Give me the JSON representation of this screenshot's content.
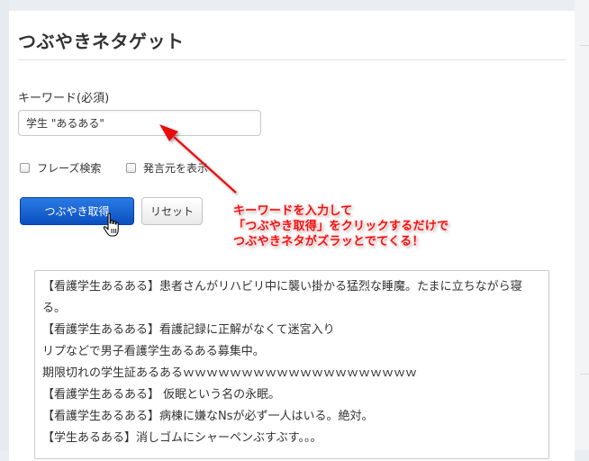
{
  "page": {
    "title": "つぶやきネタゲット"
  },
  "form": {
    "keyword_label": "キーワード(必須)",
    "keyword_value": "学生 \"あるある\"",
    "phrase_search_label": "フレーズ検索",
    "show_speaker_label": "発言元を表示",
    "submit_label": "つぶやき取得",
    "reset_label": "リセット"
  },
  "annotation": {
    "lines": [
      "キーワードを入力して",
      "「つぶやき取得」をクリックするだけで",
      "つぶやきネタがズラッとでてくる！"
    ],
    "color": "#ee1111"
  },
  "results": {
    "lines": [
      "【看護学生あるある】患者さんがリハビリ中に襲い掛かる猛烈な睡魔。たまに立ちながら寝る。",
      "【看護学生あるある】看護記録に正解がなくて迷宮入り",
      "リプなどで男子看護学生あるある募集中。",
      "期限切れの学生証あるあるｗｗｗｗｗｗｗｗｗｗｗｗｗｗｗｗｗｗｗｗ",
      "【看護学生あるある】 仮眠という名の永眠。",
      "【看護学生あるある】病棟に嫌なNsが必ず一人はいる。絶対。",
      "【学生あるある】消しゴムにシャーペンぶすぶす。。。"
    ]
  }
}
